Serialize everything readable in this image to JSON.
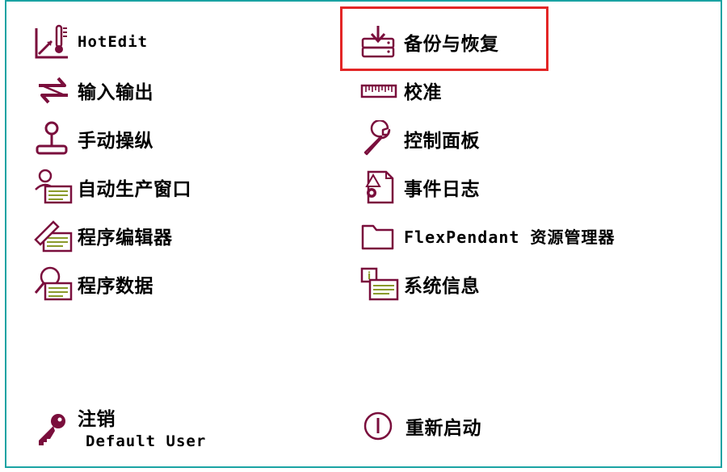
{
  "menu": {
    "left": [
      {
        "label": "HotEdit",
        "icon": "hotedit-icon"
      },
      {
        "label": "输入输出",
        "icon": "io-arrows-icon"
      },
      {
        "label": "手动操纵",
        "icon": "joystick-icon"
      },
      {
        "label": "自动生产窗口",
        "icon": "auto-production-icon"
      },
      {
        "label": "程序编辑器",
        "icon": "program-editor-icon"
      },
      {
        "label": "程序数据",
        "icon": "program-data-icon"
      }
    ],
    "right": [
      {
        "label": "备份与恢复",
        "icon": "backup-restore-icon"
      },
      {
        "label": "校准",
        "icon": "calibration-ruler-icon"
      },
      {
        "label": "控制面板",
        "icon": "wrench-icon"
      },
      {
        "label": "事件日志",
        "icon": "event-log-icon"
      },
      {
        "label": "FlexPendant 资源管理器",
        "icon": "folder-icon"
      },
      {
        "label": "系统信息",
        "icon": "system-info-icon"
      }
    ]
  },
  "footer": {
    "logout_label": "注销",
    "user_name": "Default User",
    "restart_label": "重新启动"
  },
  "colors": {
    "icon": "#7a0e3c",
    "frame": "#1aa3a3",
    "highlight": "#e32626"
  }
}
